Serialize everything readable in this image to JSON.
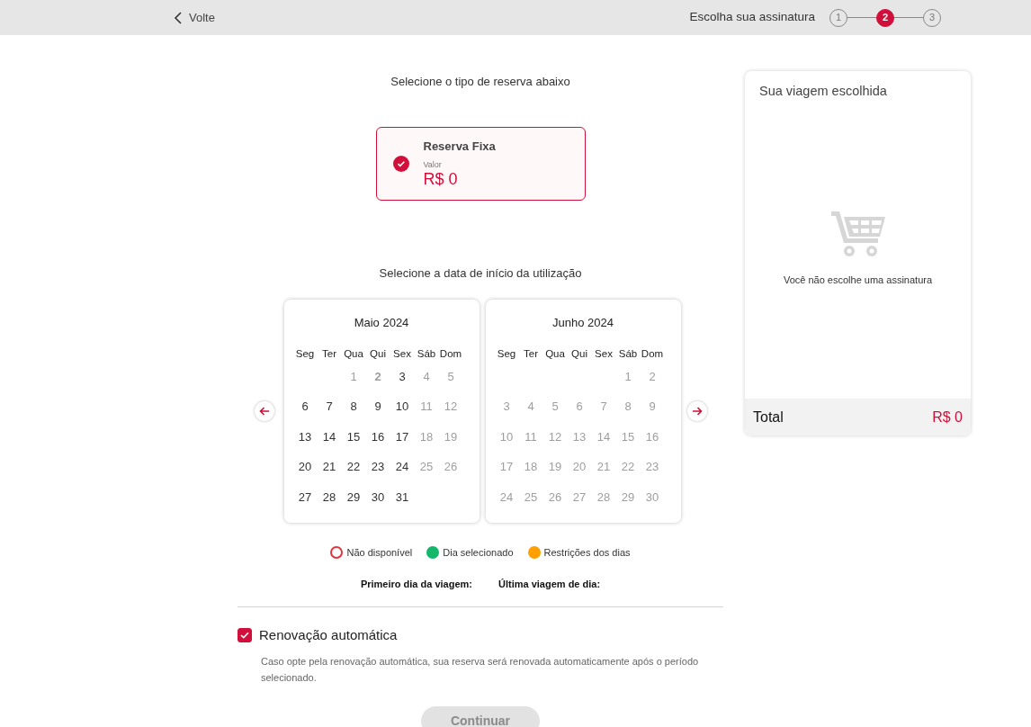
{
  "header": {
    "back_label": "Volte",
    "step_title": "Escolha sua assinatura",
    "steps": [
      {
        "label": "1",
        "selected": false
      },
      {
        "label": "2",
        "selected": true
      },
      {
        "label": "3",
        "selected": false
      }
    ]
  },
  "reservation": {
    "heading": "Selecione o tipo de reserva abaixo",
    "options": [
      {
        "title": "Reserva Fixa",
        "value_label": "Valor",
        "price": "R$ 0",
        "selected": true
      }
    ]
  },
  "calendar": {
    "heading": "Selecione a data de início da utilização",
    "months": [
      {
        "title": "Maio 2024",
        "weekdays": [
          "Seg",
          "Ter",
          "Qua",
          "Qui",
          "Sex",
          "Sáb",
          "Dom"
        ],
        "weeks": [
          {
            "days": [
              {
                "label": "1",
                "disabled": true,
                "today": false
              },
              {
                "label": "2",
                "disabled": true,
                "today": true
              },
              {
                "label": "3",
                "disabled": false,
                "today": false
              },
              {
                "label": "4",
                "disabled": true,
                "today": false
              },
              {
                "label": "5",
                "disabled": true,
                "today": false
              }
            ]
          },
          {
            "days": [
              {
                "label": "6",
                "disabled": false,
                "today": false
              },
              {
                "label": "7",
                "disabled": false,
                "today": false
              },
              {
                "label": "8",
                "disabled": false,
                "today": false
              },
              {
                "label": "9",
                "disabled": false,
                "today": false
              },
              {
                "label": "10",
                "disabled": false,
                "today": false
              },
              {
                "label": "11",
                "disabled": true,
                "today": false
              },
              {
                "label": "12",
                "disabled": true,
                "today": false
              }
            ]
          },
          {
            "days": [
              {
                "label": "13",
                "disabled": false,
                "today": false
              },
              {
                "label": "14",
                "disabled": false,
                "today": false
              },
              {
                "label": "15",
                "disabled": false,
                "today": false
              },
              {
                "label": "16",
                "disabled": false,
                "today": false
              },
              {
                "label": "17",
                "disabled": false,
                "today": false
              },
              {
                "label": "18",
                "disabled": true,
                "today": false
              },
              {
                "label": "19",
                "disabled": true,
                "today": false
              }
            ]
          },
          {
            "days": [
              {
                "label": "20",
                "disabled": false,
                "today": false
              },
              {
                "label": "21",
                "disabled": false,
                "today": false
              },
              {
                "label": "22",
                "disabled": false,
                "today": false
              },
              {
                "label": "23",
                "disabled": false,
                "today": false
              },
              {
                "label": "24",
                "disabled": false,
                "today": false
              },
              {
                "label": "25",
                "disabled": true,
                "today": false
              },
              {
                "label": "26",
                "disabled": true,
                "today": false
              }
            ]
          },
          {
            "days": [
              {
                "label": "27",
                "disabled": false,
                "today": false
              },
              {
                "label": "28",
                "disabled": false,
                "today": false
              },
              {
                "label": "29",
                "disabled": false,
                "today": false
              },
              {
                "label": "30",
                "disabled": false,
                "today": false
              },
              {
                "label": "31",
                "disabled": false,
                "today": false
              }
            ]
          }
        ]
      },
      {
        "title": "Junho 2024",
        "weekdays": [
          "Seg",
          "Ter",
          "Qua",
          "Qui",
          "Sex",
          "Sáb",
          "Dom"
        ],
        "weeks": [
          {
            "days": [
              {
                "label": "1",
                "disabled": true,
                "today": false
              },
              {
                "label": "2",
                "disabled": true,
                "today": false
              }
            ]
          },
          {
            "days": [
              {
                "label": "3",
                "disabled": true,
                "today": false
              },
              {
                "label": "4",
                "disabled": true,
                "today": false
              },
              {
                "label": "5",
                "disabled": true,
                "today": false
              },
              {
                "label": "6",
                "disabled": true,
                "today": false
              },
              {
                "label": "7",
                "disabled": true,
                "today": false
              },
              {
                "label": "8",
                "disabled": true,
                "today": false
              },
              {
                "label": "9",
                "disabled": true,
                "today": false
              }
            ]
          },
          {
            "days": [
              {
                "label": "10",
                "disabled": true,
                "today": false
              },
              {
                "label": "11",
                "disabled": true,
                "today": false
              },
              {
                "label": "12",
                "disabled": true,
                "today": false
              },
              {
                "label": "13",
                "disabled": true,
                "today": false
              },
              {
                "label": "14",
                "disabled": true,
                "today": false
              },
              {
                "label": "15",
                "disabled": true,
                "today": false
              },
              {
                "label": "16",
                "disabled": true,
                "today": false
              }
            ]
          },
          {
            "days": [
              {
                "label": "17",
                "disabled": true,
                "today": false
              },
              {
                "label": "18",
                "disabled": true,
                "today": false
              },
              {
                "label": "19",
                "disabled": true,
                "today": false
              },
              {
                "label": "20",
                "disabled": true,
                "today": false
              },
              {
                "label": "21",
                "disabled": true,
                "today": false
              },
              {
                "label": "22",
                "disabled": true,
                "today": false
              },
              {
                "label": "23",
                "disabled": true,
                "today": false
              }
            ]
          },
          {
            "days": [
              {
                "label": "24",
                "disabled": true,
                "today": false
              },
              {
                "label": "25",
                "disabled": true,
                "today": false
              },
              {
                "label": "26",
                "disabled": true,
                "today": false
              },
              {
                "label": "27",
                "disabled": true,
                "today": false
              },
              {
                "label": "28",
                "disabled": true,
                "today": false
              },
              {
                "label": "29",
                "disabled": true,
                "today": false
              },
              {
                "label": "30",
                "disabled": true,
                "today": false
              }
            ]
          }
        ]
      }
    ],
    "legend": [
      {
        "kind": "ring",
        "label": "Não disponível",
        "color": "#e0343f"
      },
      {
        "kind": "dot",
        "label": "Dia selecionado",
        "color": "#12b76a"
      },
      {
        "kind": "dot",
        "label": "Restrições dos dias",
        "color": "#ff9f00"
      }
    ],
    "summary": [
      "Primeiro dia da viagem:",
      "Última viagem de dia:"
    ]
  },
  "auto_renew": {
    "label": "Renovação automática",
    "checked": true,
    "description": "Caso opte pela renovação automática, sua reserva será renovada automaticamente após o período selecionado."
  },
  "continue_button": {
    "label": "Continuar",
    "disabled": true
  },
  "cart": {
    "title": "Sua viagem escolhida",
    "empty_message": "Você não escolhe uma assinatura",
    "total_label": "Total",
    "total_value": "R$ 0"
  }
}
